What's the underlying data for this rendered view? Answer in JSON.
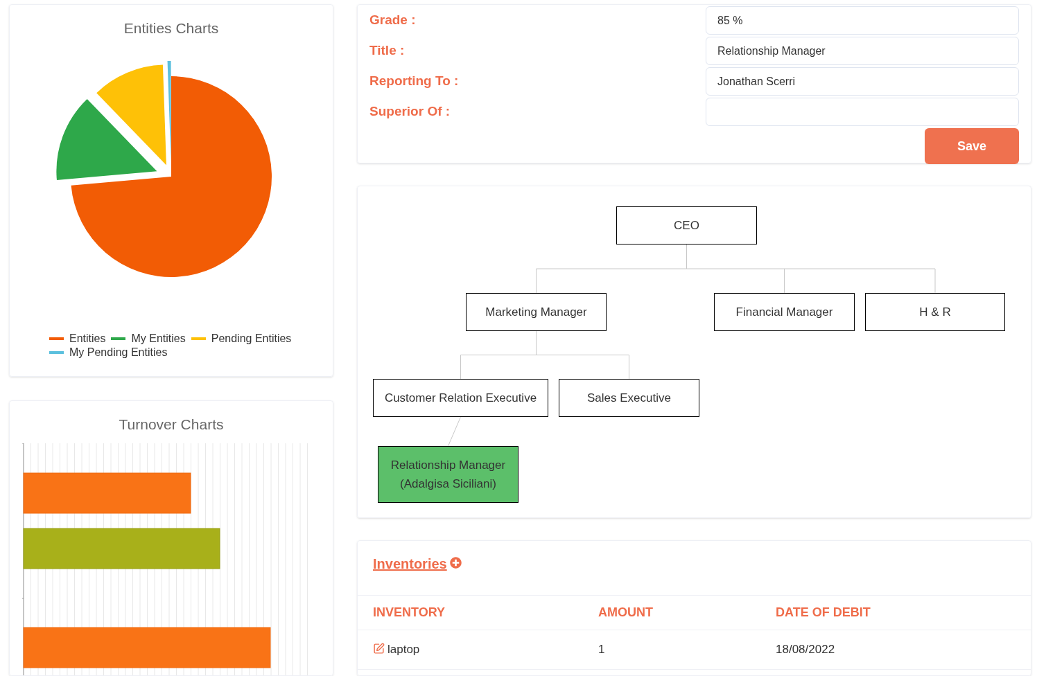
{
  "entities_chart": {
    "title": "Entities Charts",
    "legend": [
      {
        "label": "Entities",
        "color": "#f25c05"
      },
      {
        "label": "My Entities",
        "color": "#2ea84a"
      },
      {
        "label": "Pending Entities",
        "color": "#fec107"
      },
      {
        "label": "My Pending Entities",
        "color": "#5bc0de"
      }
    ]
  },
  "turnover_chart": {
    "title": "Turnover Charts"
  },
  "profile_form": {
    "fields": [
      {
        "label": "Grade :",
        "value": "85 %"
      },
      {
        "label": "Title :",
        "value": "Relationship Manager"
      },
      {
        "label": "Reporting To :",
        "value": "Jonathan Scerri"
      },
      {
        "label": "Superior Of :"
      }
    ],
    "save_button": "Save"
  },
  "org_chart": {
    "root": {
      "label": "CEO",
      "highlighted": false,
      "children": [
        {
          "label": "Marketing Manager",
          "highlighted": false,
          "children": [
            {
              "label": "Customer Relation Executive",
              "highlighted": false,
              "children": [
                {
                  "label": "Relationship Manager (Adalgisa Siciliani)",
                  "highlighted": true
                }
              ]
            },
            {
              "label": "Sales Executive",
              "highlighted": false
            }
          ]
        },
        {
          "label": "Financial Manager",
          "highlighted": false
        },
        {
          "label": "H & R",
          "highlighted": false
        }
      ]
    }
  },
  "inventories": {
    "title": "Inventories",
    "columns": [
      "INVENTORY",
      "AMOUNT",
      "DATE OF DEBIT"
    ],
    "rows": [
      {
        "cells": [
          "laptop",
          "1",
          "18/08/2022"
        ]
      }
    ]
  }
}
